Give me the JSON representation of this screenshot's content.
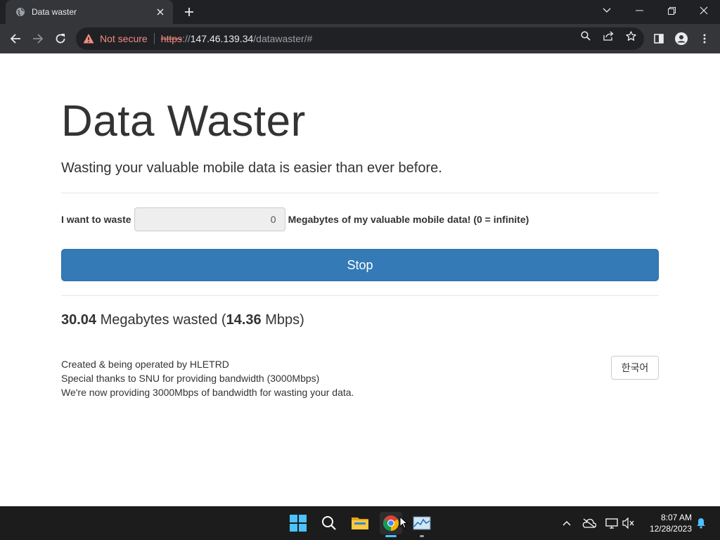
{
  "browser": {
    "tab_title": "Data waster",
    "security_label": "Not secure",
    "url_scheme": "https",
    "url_sep": "://",
    "url_host": "147.46.139.34",
    "url_path": "/datawaster/#"
  },
  "page": {
    "heading": "Data Waster",
    "lead": "Wasting your valuable mobile data is easier than ever before.",
    "form_prefix": "I want to waste",
    "amount_value": "0",
    "form_suffix": "Megabytes of my valuable mobile data! (0 = infinite)",
    "stop_label": "Stop",
    "wasted_mb": "30.04",
    "wasted_text": " Megabytes wasted (",
    "speed": "14.36",
    "speed_unit": " Mbps)",
    "footer_lines": [
      "Created & being operated by HLETRD",
      "Special thanks to SNU for providing bandwidth (3000Mbps)",
      "We're now providing 3000Mbps of bandwidth for wasting your data."
    ],
    "lang_button": "한국어"
  },
  "taskbar": {
    "time": "8:07 AM",
    "date": "12/28/2023"
  },
  "colors": {
    "primary": "#337ab7",
    "warning": "#f28b82",
    "chrome_dark": "#202124",
    "chrome_toolbar": "#35363a"
  }
}
